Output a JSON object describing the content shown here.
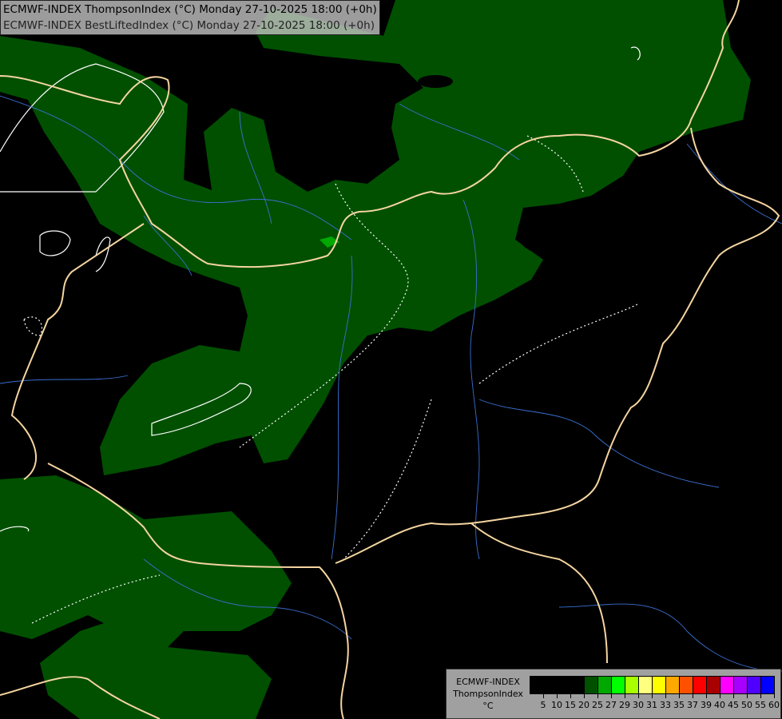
{
  "title": {
    "line1": "ECMWF-INDEX ThompsonIndex (°C) Monday 27-10-2025 18:00 (+0h)",
    "line2": "ECMWF-INDEX BestLiftedIndex (°C) Monday 27-10-2025 18:00 (+0h)"
  },
  "legend": {
    "line1": "ECMWF-INDEX",
    "line2": "ThompsonIndex",
    "unit": "°C",
    "colors": [
      "#000000",
      "#000000",
      "#000000",
      "#000000",
      "#005000",
      "#00a800",
      "#00ff00",
      "#a8ff00",
      "#ffff80",
      "#ffff00",
      "#ffa800",
      "#ff5000",
      "#ff0000",
      "#a80000",
      "#ff00ff",
      "#a800ff",
      "#5000ff",
      "#0000ff"
    ],
    "ticks": [
      "5",
      "10",
      "15",
      "20",
      "25",
      "27",
      "29",
      "30",
      "31",
      "33",
      "35",
      "37",
      "39",
      "40",
      "45",
      "50",
      "55",
      "60"
    ]
  },
  "colors": {
    "index_fill": "#005000",
    "index_high": "#00a800",
    "border": "#f5d5a0",
    "river": "#3a6fd0",
    "contour": "#ffffff"
  }
}
